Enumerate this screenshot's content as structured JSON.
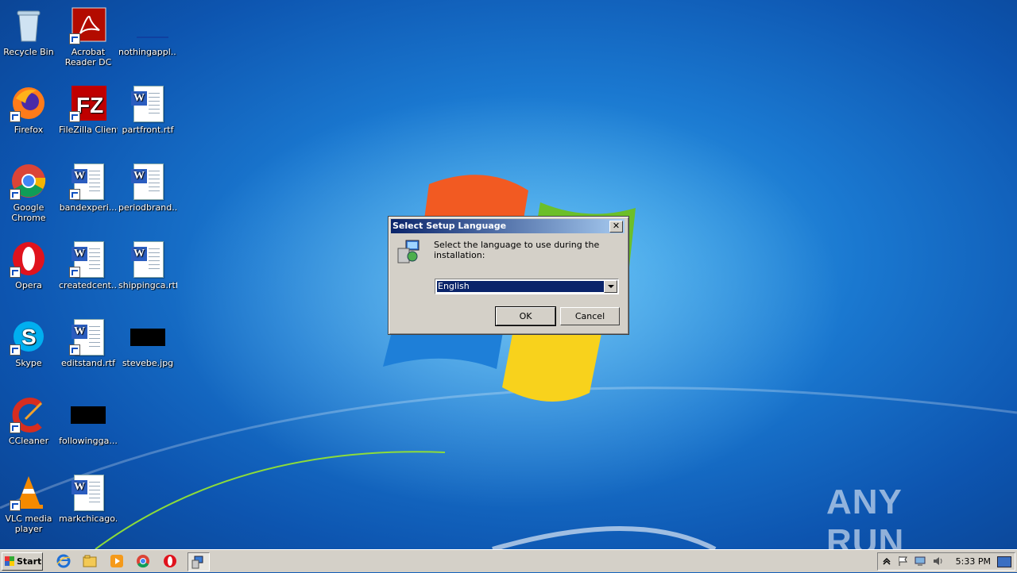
{
  "desktop": {
    "icons": [
      {
        "label": "Recycle Bin"
      },
      {
        "label": "Acrobat Reader DC"
      },
      {
        "label": "nothingappl..."
      },
      {
        "label": "Firefox"
      },
      {
        "label": "FileZilla Client"
      },
      {
        "label": "partfront.rtf"
      },
      {
        "label": "Google Chrome"
      },
      {
        "label": "bandexperi..."
      },
      {
        "label": "periodbrand..."
      },
      {
        "label": "Opera"
      },
      {
        "label": "createdcent..."
      },
      {
        "label": "shippingca.rtf"
      },
      {
        "label": "Skype"
      },
      {
        "label": "editstand.rtf"
      },
      {
        "label": "stevebe.jpg"
      },
      {
        "label": "CCleaner"
      },
      {
        "label": "followingga..."
      },
      {
        "label": "VLC media player"
      },
      {
        "label": "markchicago..."
      }
    ]
  },
  "dialog": {
    "title": "Select Setup Language",
    "close_glyph": "✕",
    "prompt": "Select the language to use during the installation:",
    "language_selected": "English",
    "ok_label": "OK",
    "cancel_label": "Cancel"
  },
  "taskbar": {
    "start_label": "Start",
    "clock": "5:33 PM"
  },
  "watermark": {
    "text": "ANY RUN"
  }
}
